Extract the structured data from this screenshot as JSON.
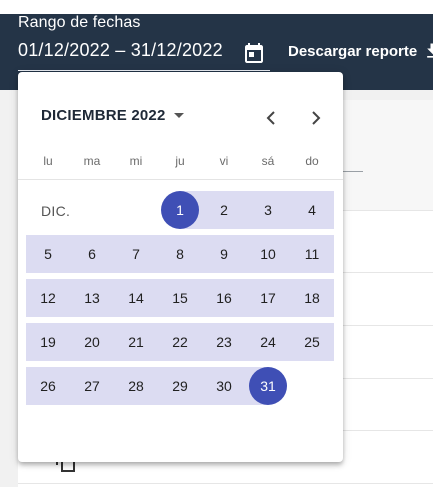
{
  "header": {
    "field_label": "Rango de fechas",
    "date_range": "01/12/2022 – 31/12/2022",
    "download_label": "Descargar reporte"
  },
  "icons": {
    "calendar": "calendar-icon",
    "download": "download-icon",
    "prev": "chevron-left-icon",
    "next": "chevron-right-icon",
    "caret": "arrow-drop-down-icon"
  },
  "colors": {
    "header_bg": "#243447",
    "range_fill": "#dcdcf2",
    "selected": "#3f4fb5"
  },
  "calendar": {
    "period_label": "DICIEMBRE 2022",
    "month_label": "DIC.",
    "weekdays": [
      "lu",
      "ma",
      "mi",
      "ju",
      "vi",
      "sá",
      "do"
    ],
    "weeks": [
      [
        "",
        "",
        "",
        "1",
        "2",
        "3",
        "4"
      ],
      [
        "5",
        "6",
        "7",
        "8",
        "9",
        "10",
        "11"
      ],
      [
        "12",
        "13",
        "14",
        "15",
        "16",
        "17",
        "18"
      ],
      [
        "19",
        "20",
        "21",
        "22",
        "23",
        "24",
        "25"
      ],
      [
        "26",
        "27",
        "28",
        "29",
        "30",
        "31",
        ""
      ]
    ],
    "range_start": "1",
    "range_end": "31"
  }
}
